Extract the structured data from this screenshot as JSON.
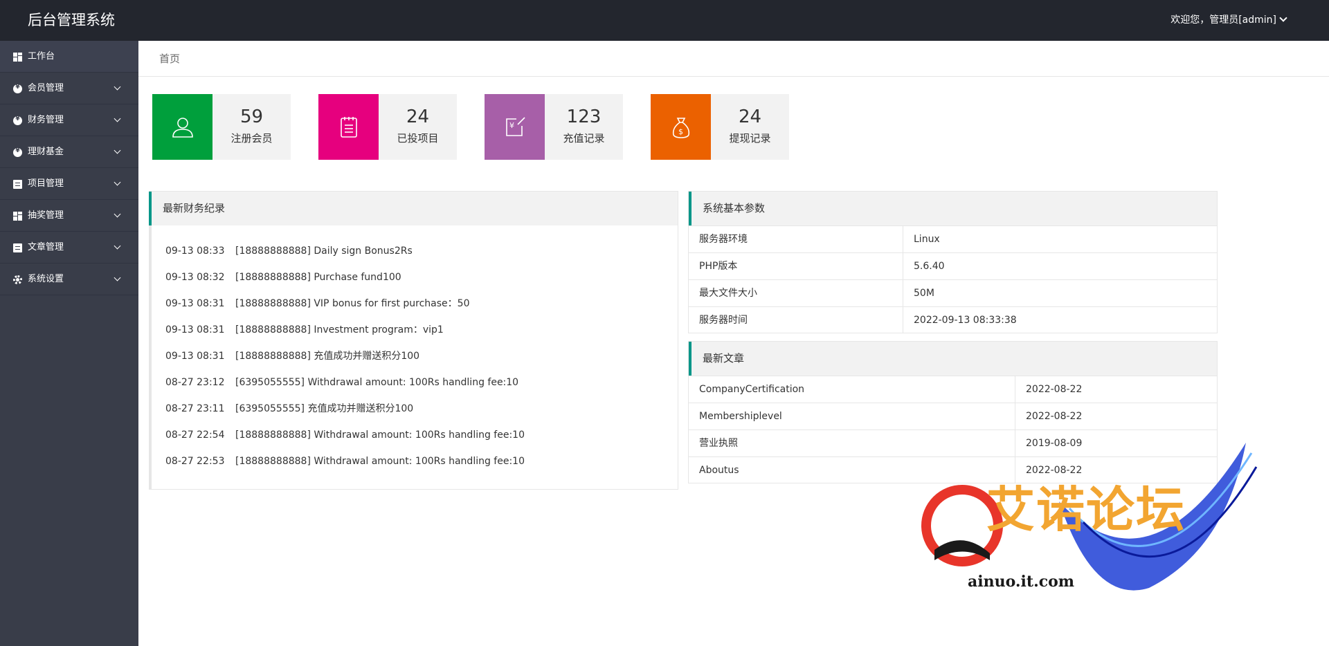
{
  "header": {
    "app_title": "后台管理系统",
    "user_greeting": "欢迎您，管理员[admin]"
  },
  "sidebar": {
    "items": [
      {
        "label": "工作台",
        "icon": "dashboard-grid-icon"
      },
      {
        "label": "会员管理",
        "icon": "yen-circle-icon"
      },
      {
        "label": "财务管理",
        "icon": "yen-circle-icon"
      },
      {
        "label": "理财基金",
        "icon": "yen-circle-icon"
      },
      {
        "label": "项目管理",
        "icon": "document-icon"
      },
      {
        "label": "抽奖管理",
        "icon": "dashboard-grid-icon"
      },
      {
        "label": "文章管理",
        "icon": "document-icon"
      },
      {
        "label": "系统设置",
        "icon": "gear-icon"
      }
    ]
  },
  "breadcrumb": "首页",
  "stats": [
    {
      "value": "59",
      "label": "注册会员",
      "color": "#009f3c",
      "icon": "user-icon"
    },
    {
      "value": "24",
      "label": "已投项目",
      "color": "#e6007e",
      "icon": "clipboard-icon"
    },
    {
      "value": "123",
      "label": "充值记录",
      "color": "#a75fa8",
      "icon": "recharge-icon"
    },
    {
      "value": "24",
      "label": "提现记录",
      "color": "#eb6100",
      "icon": "money-bag-icon"
    }
  ],
  "finance_panel": {
    "title": "最新财务纪录",
    "rows": [
      {
        "time": "09-13 08:33",
        "text": "[18888888888] Daily sign Bonus2Rs"
      },
      {
        "time": "09-13 08:32",
        "text": "[18888888888] Purchase fund100"
      },
      {
        "time": "09-13 08:31",
        "text": "[18888888888] VIP bonus for first purchase：50"
      },
      {
        "time": "09-13 08:31",
        "text": "[18888888888] Investment program：vip1"
      },
      {
        "time": "09-13 08:31",
        "text": "[18888888888] 充值成功并赠送积分100"
      },
      {
        "time": "08-27 23:12",
        "text": "[6395055555] Withdrawal amount: 100Rs handling fee:10"
      },
      {
        "time": "08-27 23:11",
        "text": "[6395055555] 充值成功并赠送积分100"
      },
      {
        "time": "08-27 22:54",
        "text": "[18888888888] Withdrawal amount: 100Rs handling fee:10"
      },
      {
        "time": "08-27 22:53",
        "text": "[18888888888] Withdrawal amount: 100Rs handling fee:10"
      }
    ]
  },
  "system_panel": {
    "title": "系统基本参数",
    "rows": [
      {
        "key": "服务器环境",
        "value": "Linux"
      },
      {
        "key": "PHP版本",
        "value": "5.6.40"
      },
      {
        "key": "最大文件大小",
        "value": "50M"
      },
      {
        "key": "服务器时间",
        "value": "2022-09-13 08:33:38"
      }
    ]
  },
  "articles_panel": {
    "title": "最新文章",
    "rows": [
      {
        "key": "CompanyCertification",
        "value": "2022-08-22"
      },
      {
        "key": "Membershiplevel",
        "value": "2022-08-22"
      },
      {
        "key": "营业执照",
        "value": "2019-08-09"
      },
      {
        "key": "Aboutus",
        "value": "2022-08-22"
      }
    ]
  },
  "watermark": {
    "text": "艾诺论坛",
    "url": "ainuo.it.com"
  },
  "colors": {
    "header_bg": "#23262e",
    "sidebar_bg": "#393d49",
    "panel_accent": "#009688"
  }
}
